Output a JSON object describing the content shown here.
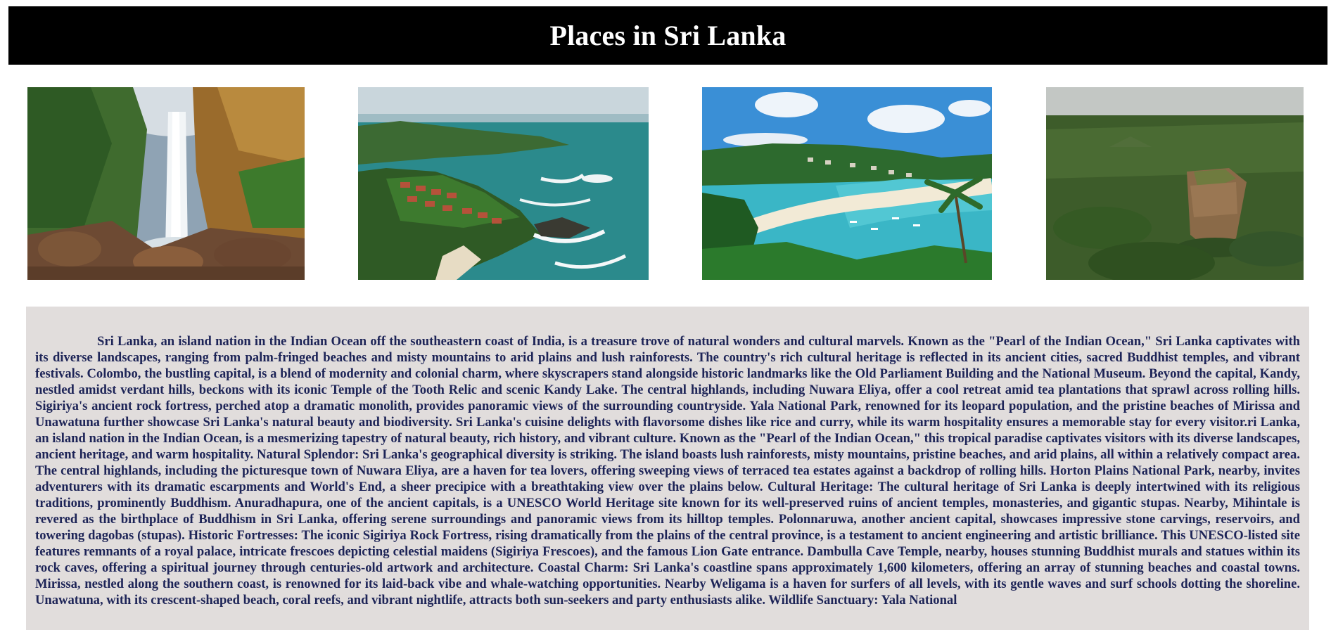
{
  "page": {
    "title": "Places in Sri Lanka"
  },
  "gallery": {
    "images": [
      {
        "subject": "waterfall"
      },
      {
        "subject": "coastal-peninsula"
      },
      {
        "subject": "beach-bay"
      },
      {
        "subject": "sigiriya-rock"
      }
    ]
  },
  "article": {
    "body": "Sri Lanka, an island nation in the Indian Ocean off the southeastern coast of India, is a treasure trove of natural wonders and cultural marvels. Known as the \"Pearl of the Indian Ocean,\" Sri Lanka captivates with its diverse landscapes, ranging from palm-fringed beaches and misty mountains to arid plains and lush rainforests. The country's rich cultural heritage is reflected in its ancient cities, sacred Buddhist temples, and vibrant festivals. Colombo, the bustling capital, is a blend of modernity and colonial charm, where skyscrapers stand alongside historic landmarks like the Old Parliament Building and the National Museum. Beyond the capital, Kandy, nestled amidst verdant hills, beckons with its iconic Temple of the Tooth Relic and scenic Kandy Lake. The central highlands, including Nuwara Eliya, offer a cool retreat amid tea plantations that sprawl across rolling hills. Sigiriya's ancient rock fortress, perched atop a dramatic monolith, provides panoramic views of the surrounding countryside. Yala National Park, renowned for its leopard population, and the pristine beaches of Mirissa and Unawatuna further showcase Sri Lanka's natural beauty and biodiversity. Sri Lanka's cuisine delights with flavorsome dishes like rice and curry, while its warm hospitality ensures a memorable stay for every visitor.ri Lanka, an island nation in the Indian Ocean, is a mesmerizing tapestry of natural beauty, rich history, and vibrant culture. Known as the \"Pearl of the Indian Ocean,\" this tropical paradise captivates visitors with its diverse landscapes, ancient heritage, and warm hospitality. Natural Splendor: Sri Lanka's geographical diversity is striking. The island boasts lush rainforests, misty mountains, pristine beaches, and arid plains, all within a relatively compact area. The central highlands, including the picturesque town of Nuwara Eliya, are a haven for tea lovers, offering sweeping views of terraced tea estates against a backdrop of rolling hills. Horton Plains National Park, nearby, invites adventurers with its dramatic escarpments and World's End, a sheer precipice with a breathtaking view over the plains below. Cultural Heritage: The cultural heritage of Sri Lanka is deeply intertwined with its religious traditions, prominently Buddhism. Anuradhapura, one of the ancient capitals, is a UNESCO World Heritage site known for its well-preserved ruins of ancient temples, monasteries, and gigantic stupas. Nearby, Mihintale is revered as the birthplace of Buddhism in Sri Lanka, offering serene surroundings and panoramic views from its hilltop temples. Polonnaruwa, another ancient capital, showcases impressive stone carvings, reservoirs, and towering dagobas (stupas). Historic Fortresses: The iconic Sigiriya Rock Fortress, rising dramatically from the plains of the central province, is a testament to ancient engineering and artistic brilliance. This UNESCO-listed site features remnants of a royal palace, intricate frescoes depicting celestial maidens (Sigiriya Frescoes), and the famous Lion Gate entrance. Dambulla Cave Temple, nearby, houses stunning Buddhist murals and statues within its rock caves, offering a spiritual journey through centuries-old artwork and architecture. Coastal Charm: Sri Lanka's coastline spans approximately 1,600 kilometers, offering an array of stunning beaches and coastal towns. Mirissa, nestled along the southern coast, is renowned for its laid-back vibe and whale-watching opportunities. Nearby Weligama is a haven for surfers of all levels, with its gentle waves and surf schools dotting the shoreline. Unawatuna, with its crescent-shaped beach, coral reefs, and vibrant nightlife, attracts both sun-seekers and party enthusiasts alike. Wildlife Sanctuary: Yala National"
  },
  "colors": {
    "header_bg": "#000000",
    "header_text": "#ffffff",
    "text_box_bg": "#e1dddc",
    "body_text": "#1d2457"
  }
}
